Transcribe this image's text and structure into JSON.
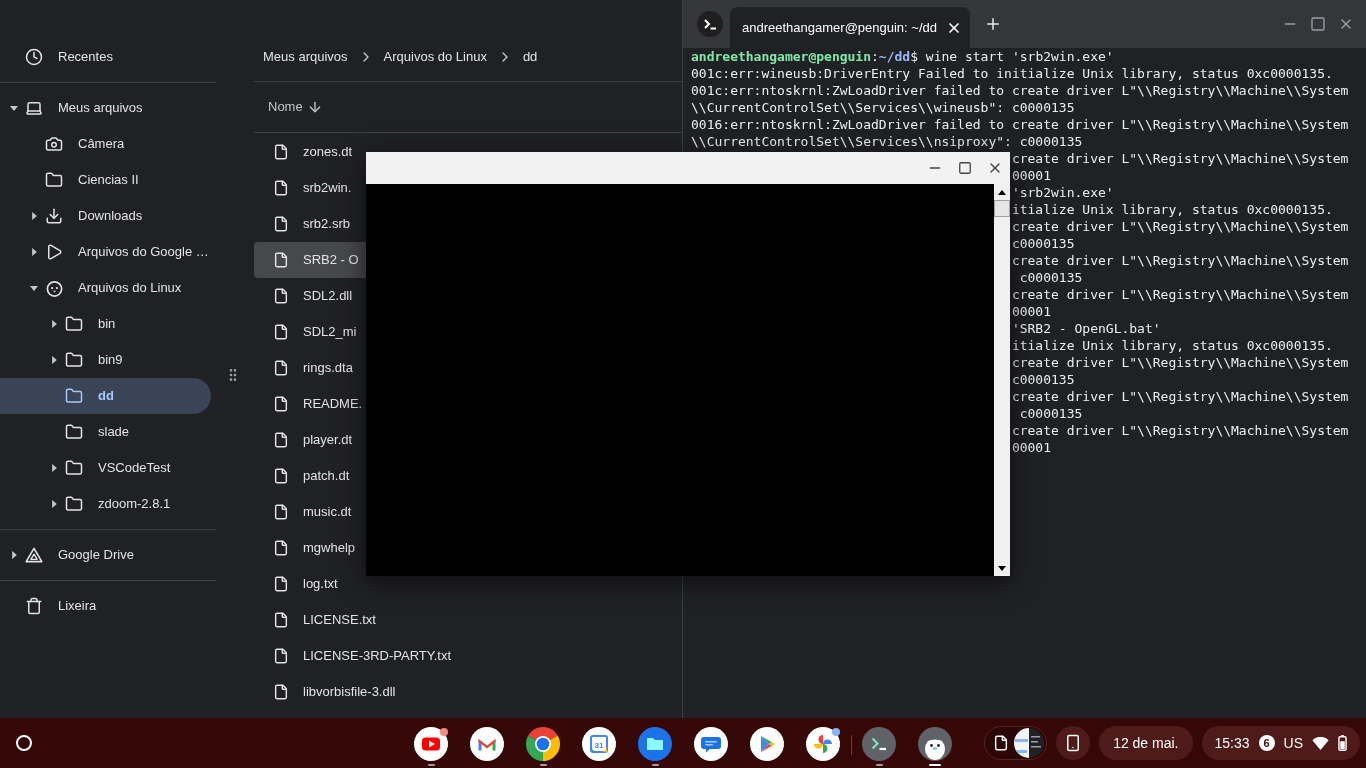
{
  "file_manager": {
    "sidebar": {
      "groups": [
        {
          "items": [
            {
              "label": "Recentes",
              "kind": "recents",
              "selected": false
            }
          ]
        },
        {
          "items": [
            {
              "label": "Meus arquivos",
              "kind": "computer",
              "selected": false,
              "expanded": true,
              "children": [
                {
                  "label": "Câmera",
                  "kind": "camera",
                  "selected": false
                },
                {
                  "label": "Ciencias II",
                  "kind": "folder",
                  "selected": false
                },
                {
                  "label": "Downloads",
                  "kind": "downloads",
                  "selected": false,
                  "expanded": false
                },
                {
                  "label": "Arquivos do Google …",
                  "kind": "play",
                  "selected": false,
                  "expanded": false
                },
                {
                  "label": "Arquivos do Linux",
                  "kind": "linux",
                  "selected": false,
                  "expanded": true,
                  "children": [
                    {
                      "label": "bin",
                      "kind": "folder",
                      "selected": false,
                      "expanded": false
                    },
                    {
                      "label": "bin9",
                      "kind": "folder",
                      "selected": false,
                      "expanded": false
                    },
                    {
                      "label": "dd",
                      "kind": "folder",
                      "selected": true
                    },
                    {
                      "label": "slade",
                      "kind": "folder",
                      "selected": false
                    },
                    {
                      "label": "VSCodeTest",
                      "kind": "folder",
                      "selected": false,
                      "expanded": false
                    },
                    {
                      "label": "zdoom-2.8.1",
                      "kind": "folder",
                      "selected": false,
                      "expanded": false
                    }
                  ]
                }
              ]
            }
          ]
        },
        {
          "items": [
            {
              "label": "Google Drive",
              "kind": "drive",
              "selected": false,
              "expanded": false
            }
          ]
        },
        {
          "items": [
            {
              "label": "Lixeira",
              "kind": "trash",
              "selected": false
            }
          ]
        }
      ]
    },
    "breadcrumb": [
      "Meus arquivos",
      "Arquivos do Linux",
      "dd"
    ],
    "table": {
      "columns": [
        {
          "label": "Nome",
          "descending": true
        }
      ],
      "rows": [
        {
          "name": "zones.dt",
          "selected": false
        },
        {
          "name": "srb2win.",
          "selected": false
        },
        {
          "name": "srb2.srb",
          "selected": false
        },
        {
          "name": "SRB2 - O",
          "selected": true
        },
        {
          "name": "SDL2.dll",
          "selected": false
        },
        {
          "name": "SDL2_mi",
          "selected": false
        },
        {
          "name": "rings.dta",
          "selected": false
        },
        {
          "name": "README.",
          "selected": false
        },
        {
          "name": "player.dt",
          "selected": false
        },
        {
          "name": "patch.dt",
          "selected": false
        },
        {
          "name": "music.dt",
          "selected": false
        },
        {
          "name": "mgwhelp",
          "selected": false
        },
        {
          "name": "log.txt",
          "selected": false
        },
        {
          "name": "LICENSE.txt",
          "selected": false
        },
        {
          "name": "LICENSE-3RD-PARTY.txt",
          "selected": false
        },
        {
          "name": "libvorbisfile-3.dll",
          "selected": false
        }
      ]
    }
  },
  "terminal": {
    "tab": {
      "title": "andreethangamer@penguin: ~/dd",
      "selected": true
    },
    "prompt": {
      "user_host": "andreethangamer@penguin",
      "separator": ":",
      "path": "~/dd",
      "command": "$ wine start 'srb2win.exe'"
    },
    "lines": [
      {
        "kind": "full",
        "text": "001c:err:wineusb:DriverEntry Failed to initialize Unix library, status 0xc0000135."
      },
      {
        "kind": "full",
        "text": "001c:err:ntoskrnl:ZwLoadDriver failed to create driver L\"\\\\Registry\\\\Machine\\\\System"
      },
      {
        "kind": "full",
        "text": "\\\\CurrentControlSet\\\\Services\\\\wineusb\": c0000135"
      },
      {
        "kind": "full",
        "text": "0016:err:ntoskrnl:ZwLoadDriver failed to create driver L\"\\\\Registry\\\\Machine\\\\System"
      },
      {
        "kind": "full",
        "text": "\\\\CurrentControlSet\\\\Services\\\\nsiproxy\": c0000135"
      },
      {
        "kind": "covered",
        "text": "create driver L\"\\\\Registry\\\\Machine\\\\System"
      },
      {
        "kind": "covered",
        "text": "00001"
      },
      {
        "kind": "covered",
        "text": "'srb2win.exe'"
      },
      {
        "kind": "covered",
        "text": "itialize Unix library, status 0xc0000135."
      },
      {
        "kind": "covered",
        "text": "create driver L\"\\\\Registry\\\\Machine\\\\System"
      },
      {
        "kind": "covered",
        "text": "c0000135"
      },
      {
        "kind": "covered",
        "text": "create driver L\"\\\\Registry\\\\Machine\\\\System"
      },
      {
        "kind": "covered",
        "text": " c0000135"
      },
      {
        "kind": "covered",
        "text": "create driver L\"\\\\Registry\\\\Machine\\\\System"
      },
      {
        "kind": "covered",
        "text": "00001"
      },
      {
        "kind": "covered",
        "text": "'SRB2 - OpenGL.bat'"
      },
      {
        "kind": "covered",
        "text": "itialize Unix library, status 0xc0000135."
      },
      {
        "kind": "covered",
        "text": "create driver L\"\\\\Registry\\\\Machine\\\\System"
      },
      {
        "kind": "covered",
        "text": "c0000135"
      },
      {
        "kind": "covered",
        "text": "create driver L\"\\\\Registry\\\\Machine\\\\System"
      },
      {
        "kind": "covered",
        "text": " c0000135"
      },
      {
        "kind": "covered",
        "text": "create driver L\"\\\\Registry\\\\Machine\\\\System"
      },
      {
        "kind": "covered",
        "text": "00001"
      }
    ]
  },
  "taskbar": {
    "pinned_apps": [
      {
        "kind": "video",
        "running": true,
        "focused": false,
        "badge": {
          "color": "#f28b82"
        }
      },
      {
        "kind": "mail",
        "running": false,
        "focused": false
      },
      {
        "kind": "browser",
        "running": true,
        "focused": false
      },
      {
        "kind": "calendar",
        "running": false,
        "focused": false,
        "glyph": "31"
      },
      {
        "kind": "files",
        "running": true,
        "focused": false
      },
      {
        "kind": "messages",
        "running": false,
        "focused": false
      },
      {
        "kind": "store",
        "running": false,
        "focused": false
      },
      {
        "kind": "photos",
        "running": false,
        "focused": false,
        "badge": {
          "color": "#8ab4f8"
        }
      }
    ],
    "other_apps": [
      {
        "kind": "terminal",
        "running": true,
        "focused": false
      },
      {
        "kind": "linux",
        "running": true,
        "focused": true
      }
    ],
    "tray": {
      "date": "12 de mai.",
      "time": "15:33",
      "notification_count": "6",
      "input_method": "US"
    }
  }
}
